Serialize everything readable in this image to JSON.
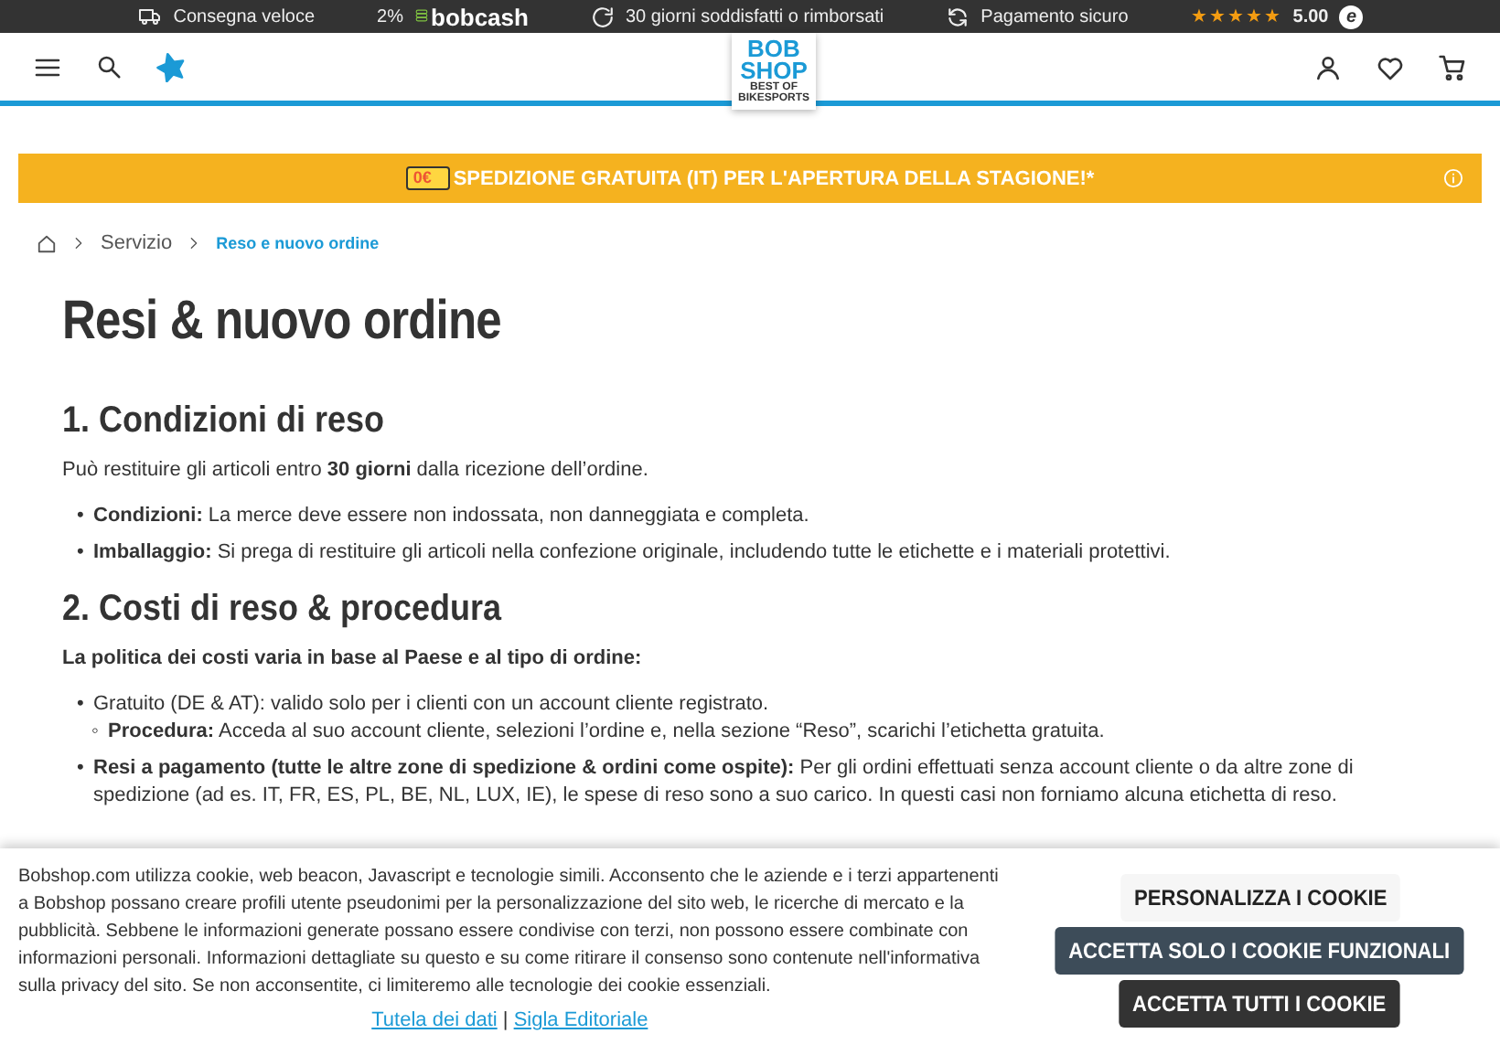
{
  "top_bar": {
    "usps": [
      {
        "text": "Consegna veloce"
      },
      {
        "percent": "2%",
        "brand_a": "bob",
        "brand_b": "cash"
      },
      {
        "text": "30 giorni soddisfatti o rimborsati"
      },
      {
        "text": "Pagamento sicuro"
      }
    ],
    "rating": {
      "stars": 5,
      "score": "5.00",
      "badge": "e"
    }
  },
  "header": {
    "logo": {
      "line1": "BOB",
      "line2": "SHOP",
      "tagline": "BEST OF BIKESPORTS"
    }
  },
  "promo": {
    "badge": "0€",
    "text": "SPEDIZIONE GRATUITA (IT) PER L'APERTURA DELLA STAGIONE!*"
  },
  "breadcrumb": [
    {
      "label": "Servizio",
      "current": false
    },
    {
      "label": "Reso e nuovo ordine",
      "current": true
    }
  ],
  "title": "Resi & nuovo ordine",
  "sections": [
    {
      "heading": "1. Condizioni di reso",
      "blocks": [
        {
          "kind": "paragraph",
          "text": "Può restituire gli articoli entro **30 giorni** dalla ricezione dell’ordine."
        },
        {
          "kind": "list",
          "items": [
            {
              "marker": "•",
              "text": "**Condizioni:** La merce deve essere non indossata, non danneggiata e completa."
            },
            {
              "marker": "•",
              "text": "**Imballaggio:** Si prega di restituire gli articoli nella confezione originale, includendo tutte le etichette e i materiali protettivi."
            }
          ]
        }
      ]
    },
    {
      "heading": "2. Costi di reso & procedura",
      "blocks": [
        {
          "kind": "lead",
          "text": "La politica dei costi varia in base al Paese e al tipo di ordine:"
        },
        {
          "kind": "list",
          "items": [
            {
              "marker": "•",
              "text": "Gratuito (DE & AT): valido solo per i clienti con un account cliente registrato.",
              "children": [
                {
                  "marker": "◦",
                  "text": "**Procedura:** Acceda al suo account cliente, selezioni l’ordine e, nella sezione “Reso”, scarichi l’etichetta gratuita."
                }
              ]
            },
            {
              "marker": "•",
              "text": "**Resi a pagamento (tutte le altre zone di spedizione & ordini come ospite):** Per gli ordini effettuati senza account cliente o da altre zone di spedizione (ad es. IT, FR, ES, PL, BE, NL, LUX, IE), le spese di reso sono a suo carico. In questi casi non forniamo alcuna etichetta di reso."
            }
          ]
        }
      ]
    }
  ],
  "cookie_banner": {
    "text": "Bobshop.com utilizza cookie, web beacon, Javascript e tecnologie simili. Acconsento che le aziende e i terzi appartenenti a Bobshop possano creare profili utente pseudonimi per la personalizzazione del sito web, le ricerche di mercato e la pubblicità. Sebbene le informazioni generate possano essere condivise con terzi, non possono essere combinate con informazioni personali. Informazioni dettagliate su questo e su come ritirare il consenso sono contenute nell'informativa sulla privacy del sito. Se non acconsentite, ci limiteremo alle tecnologie dei cookie essenziali.",
    "links": [
      "Tutela dei dati",
      "Sigla Editoriale"
    ],
    "separator": "|",
    "buttons": [
      {
        "label": "PERSONALIZZA I COOKIE",
        "kind": "plain"
      },
      {
        "label": "ACCETTA SOLO I COOKIE FUNZIONALI",
        "kind": "secondary"
      },
      {
        "label": "ACCETTA TUTTI I COOKIE",
        "kind": "primary"
      }
    ]
  }
}
